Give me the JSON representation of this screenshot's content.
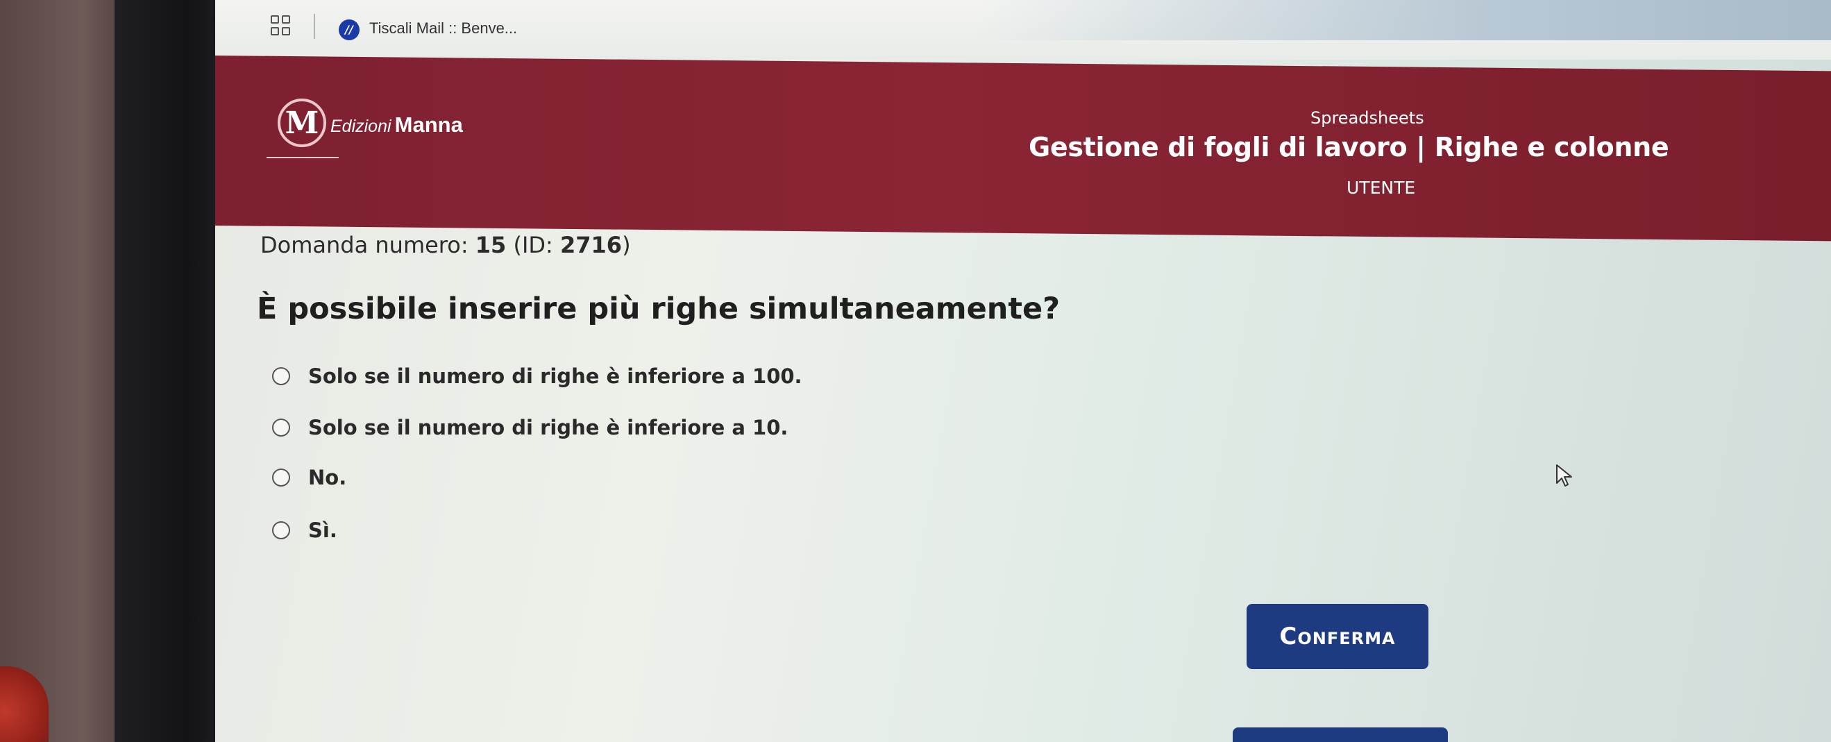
{
  "browser": {
    "bookmark_label": "Tiscali Mail :: Benve..."
  },
  "header": {
    "logo_italic": "Edizioni",
    "logo_bold": "Manna",
    "course_small": "Spreadsheets",
    "course_title": "Gestione di fogli di lavoro | Righe e colonne",
    "role": "UTENTE"
  },
  "question": {
    "number_label": "Domanda numero:",
    "number": "15",
    "id_prefix": "(ID:",
    "id": "2716",
    "id_suffix": ")",
    "text": "È possibile inserire più righe simultaneamente?"
  },
  "answers": [
    {
      "label": "Solo se il numero di righe è inferiore a 100."
    },
    {
      "label": "Solo se il numero di righe è inferiore a 10."
    },
    {
      "label": "No."
    },
    {
      "label": "Sì."
    }
  ],
  "confirm_label": "Conferma",
  "colors": {
    "header_bg": "#7e2030",
    "button_bg": "#1e3b82",
    "favicon_bg": "#1a3aa8"
  }
}
